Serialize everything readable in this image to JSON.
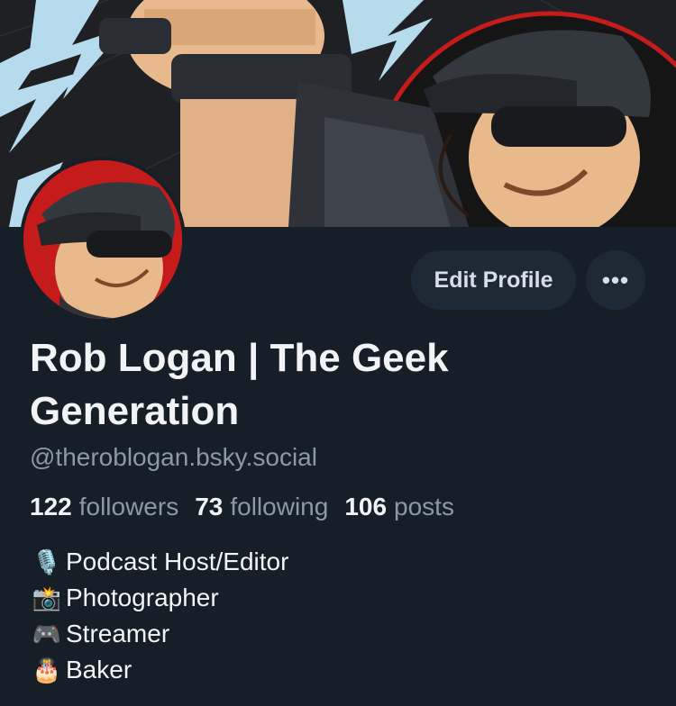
{
  "profile": {
    "display_name": "Rob Logan | The Geek Generation",
    "handle": "@theroblogan.bsky.social",
    "stats": [
      {
        "count": "122",
        "label": "followers"
      },
      {
        "count": "73",
        "label": "following"
      },
      {
        "count": "106",
        "label": "posts"
      }
    ],
    "bio": [
      {
        "icon": "microphone-icon",
        "glyph": "🎙️",
        "text": "Podcast Host/Editor"
      },
      {
        "icon": "camera-flash-icon",
        "glyph": "📸",
        "text": "Photographer"
      },
      {
        "icon": "game-controller-icon",
        "glyph": "🎮",
        "text": "Streamer"
      },
      {
        "icon": "birthday-cake-icon",
        "glyph": "🎂",
        "text": "Baker"
      }
    ]
  },
  "actions": {
    "edit_profile_label": "Edit Profile",
    "more_label": "•••"
  },
  "colors": {
    "background": "#161e27",
    "button_bg": "#1e2936",
    "primary_text": "#f1f3f5",
    "secondary_text": "#8b98a8",
    "avatar_red": "#c61b1b"
  }
}
